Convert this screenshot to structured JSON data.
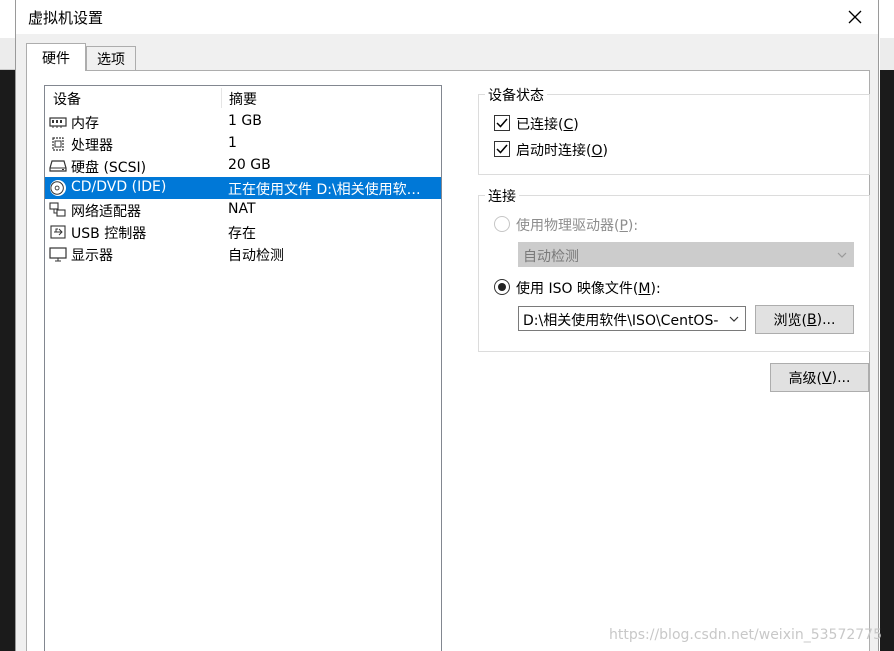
{
  "window": {
    "title": "虚拟机设置",
    "close_icon": "close-icon"
  },
  "tabs": [
    {
      "label": "硬件",
      "active": true
    },
    {
      "label": "选项",
      "active": false
    }
  ],
  "device_list": {
    "columns": [
      "设备",
      "摘要"
    ],
    "rows": [
      {
        "icon": "memory-icon",
        "name": "内存",
        "summary": "1 GB",
        "selected": false
      },
      {
        "icon": "processor-icon",
        "name": "处理器",
        "summary": "1",
        "selected": false
      },
      {
        "icon": "hard-disk-icon",
        "name": "硬盘 (SCSI)",
        "summary": "20 GB",
        "selected": false
      },
      {
        "icon": "cd-dvd-icon",
        "name": "CD/DVD (IDE)",
        "summary": "正在使用文件 D:\\相关使用软…",
        "selected": true
      },
      {
        "icon": "network-adapter-icon",
        "name": "网络适配器",
        "summary": "NAT",
        "selected": false
      },
      {
        "icon": "usb-controller-icon",
        "name": "USB 控制器",
        "summary": "存在",
        "selected": false
      },
      {
        "icon": "display-icon",
        "name": "显示器",
        "summary": "自动检测",
        "selected": false
      }
    ]
  },
  "device_status": {
    "title": "设备状态",
    "connected": {
      "label_pre": "已连接(",
      "key": "C",
      "label_post": ")",
      "checked": true
    },
    "connect_at_power_on": {
      "label_pre": "启动时连接(",
      "key": "O",
      "label_post": ")",
      "checked": true
    }
  },
  "connection": {
    "title": "连接",
    "physical_drive": {
      "label_pre": "使用物理驱动器(",
      "key": "P",
      "label_post": "):",
      "selected": false,
      "enabled": false
    },
    "physical_drive_select": "自动检测",
    "iso_image": {
      "label_pre": "使用 ISO 映像文件(",
      "key": "M",
      "label_post": "):",
      "selected": true
    },
    "iso_path": "D:\\相关使用软件\\ISO\\CentOS-",
    "browse_button": {
      "label_pre": "浏览(",
      "key": "B",
      "label_post": ")..."
    }
  },
  "advanced_button": {
    "label_pre": "高级(",
    "key": "V",
    "label_post": ")..."
  },
  "watermark": "https://blog.csdn.net/weixin_53572775"
}
